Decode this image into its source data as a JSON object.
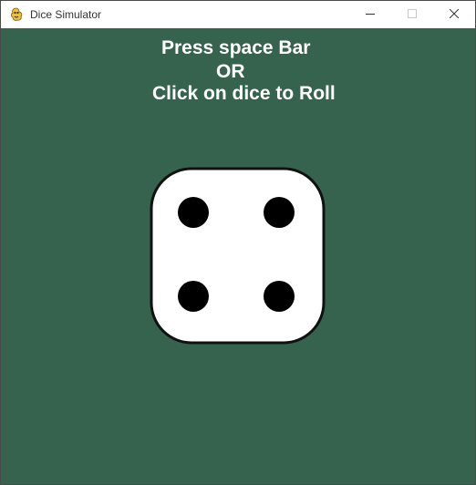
{
  "window": {
    "title": "Dice Simulator"
  },
  "instructions": {
    "line1": "Press space Bar",
    "line2": "OR",
    "line3": "Click on dice to Roll"
  },
  "dice": {
    "face_value": 4
  },
  "colors": {
    "background": "#36634e",
    "text": "#ffffff",
    "dice_face": "#ffffff",
    "pip": "#000000"
  },
  "icons": {
    "app": "pygame-snake-icon",
    "minimize": "minimize-icon",
    "maximize": "maximize-icon",
    "close": "close-icon"
  }
}
